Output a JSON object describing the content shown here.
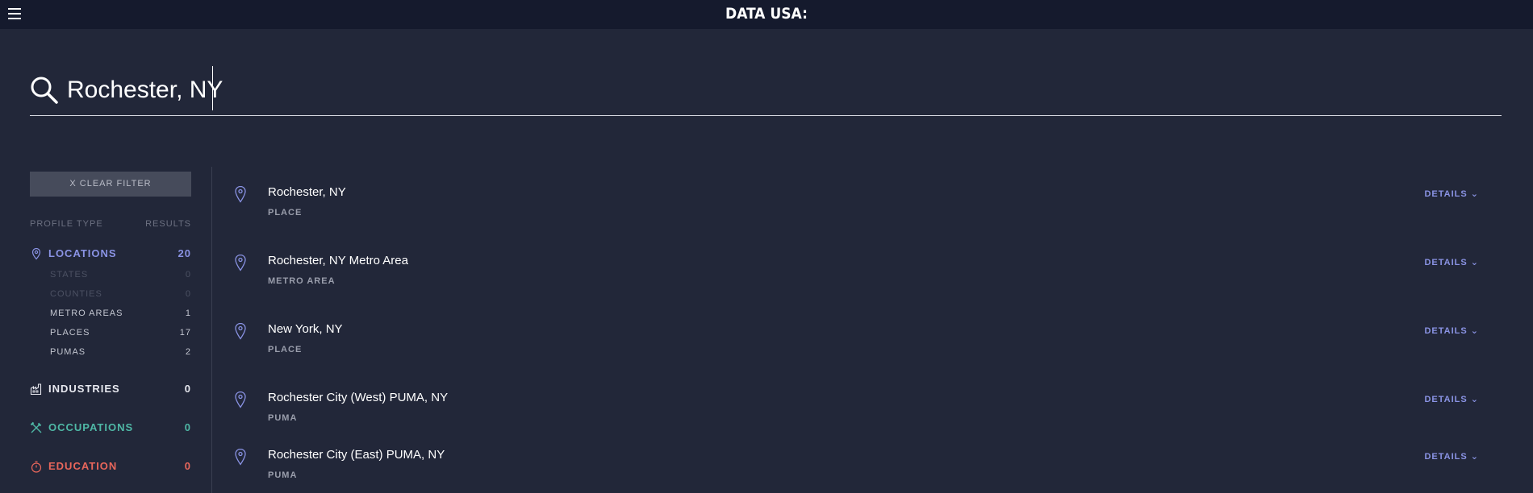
{
  "header": {
    "logo_text": "DATA USA:"
  },
  "search": {
    "value": "Rochester, NY"
  },
  "sidebar": {
    "clear_filter_label": "X  CLEAR FILTER",
    "profile_type_header": "PROFILE TYPE",
    "results_header": "RESULTS",
    "locations": {
      "label": "LOCATIONS",
      "count": "20",
      "color": "#8a93e4"
    },
    "sub_items": [
      {
        "label": "STATES",
        "count": "0",
        "enabled": false
      },
      {
        "label": "COUNTIES",
        "count": "0",
        "enabled": false
      },
      {
        "label": "METRO AREAS",
        "count": "1",
        "enabled": true
      },
      {
        "label": "PLACES",
        "count": "17",
        "enabled": true
      },
      {
        "label": "PUMAS",
        "count": "2",
        "enabled": true
      }
    ],
    "industries": {
      "label": "INDUSTRIES",
      "count": "0",
      "color": "#e7e8ef"
    },
    "occupations": {
      "label": "OCCUPATIONS",
      "count": "0",
      "color": "#4fb8a6"
    },
    "education": {
      "label": "EDUCATION",
      "count": "0",
      "color": "#e8665b"
    }
  },
  "results": [
    {
      "name": "Rochester, NY",
      "type": "PLACE",
      "details_label": "DETAILS"
    },
    {
      "name": "Rochester, NY Metro Area",
      "type": "METRO AREA",
      "details_label": "DETAILS"
    },
    {
      "name": "New York, NY",
      "type": "PLACE",
      "details_label": "DETAILS"
    },
    {
      "name": "Rochester City (West) PUMA, NY",
      "type": "PUMA",
      "details_label": "DETAILS"
    },
    {
      "name": "Rochester City (East) PUMA, NY",
      "type": "PUMA",
      "details_label": "DETAILS"
    }
  ],
  "icons": {
    "menu": "hamburger-menu-icon",
    "search": "magnifier-icon",
    "location": "map-pin-icon",
    "industries": "factory-icon",
    "occupations": "tools-icon",
    "education": "stopwatch-icon",
    "details": "chevron-down-icon"
  }
}
